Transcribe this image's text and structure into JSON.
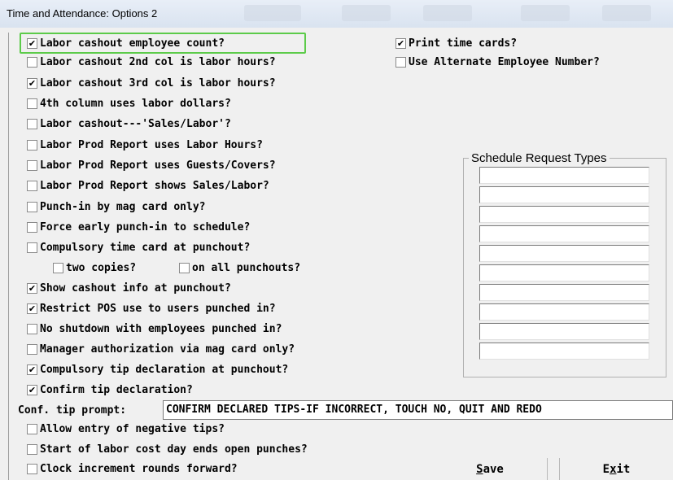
{
  "window": {
    "title": "Time and Attendance: Options 2"
  },
  "left_options": [
    {
      "label": "Labor cashout employee count?",
      "checked": true
    },
    {
      "label": "Labor cashout 2nd col is labor hours?",
      "checked": false
    },
    {
      "label": "Labor cashout 3rd col is labor hours?",
      "checked": true
    },
    {
      "label": "4th column uses labor dollars?",
      "checked": false
    },
    {
      "label": "Labor cashout---'Sales/Labor'?",
      "checked": false
    },
    {
      "label": "Labor Prod Report uses Labor Hours?",
      "checked": false
    },
    {
      "label": "Labor Prod Report uses Guests/Covers?",
      "checked": false
    },
    {
      "label": "Labor Prod Report shows Sales/Labor?",
      "checked": false
    },
    {
      "label": "Punch-in by mag card only?",
      "checked": false
    },
    {
      "label": "Force early punch-in to schedule?",
      "checked": false
    },
    {
      "label": "Compulsory time card at punchout?",
      "checked": false
    },
    {
      "label": "two copies?",
      "checked": false
    },
    {
      "label": "on all punchouts?",
      "checked": false
    },
    {
      "label": "Show cashout info at punchout?",
      "checked": true
    },
    {
      "label": "Restrict POS use to users punched in?",
      "checked": true
    },
    {
      "label": "No shutdown with employees punched in?",
      "checked": false
    },
    {
      "label": "Manager authorization via mag card only?",
      "checked": false
    },
    {
      "label": "Compulsory tip declaration at punchout?",
      "checked": true
    },
    {
      "label": "Confirm tip declaration?",
      "checked": true
    },
    {
      "label": "Allow entry of negative tips?",
      "checked": false
    },
    {
      "label": "Start of labor cost day ends open punches?",
      "checked": false
    },
    {
      "label": "Clock increment rounds forward?",
      "checked": false
    }
  ],
  "right_options": [
    {
      "label": "Print time cards?",
      "checked": true
    },
    {
      "label": "Use Alternate Employee Number?",
      "checked": false
    }
  ],
  "schedule_request_types": {
    "title": "Schedule Request Types",
    "entries": [
      "",
      "",
      "",
      "",
      "",
      "",
      "",
      "",
      "",
      ""
    ]
  },
  "tip_prompt": {
    "label": "Conf. tip prompt:",
    "value": "CONFIRM DECLARED TIPS-IF INCORRECT, TOUCH NO, QUIT AND REDO"
  },
  "buttons": {
    "save": {
      "prefix": "",
      "mnemonic": "S",
      "suffix": "ave"
    },
    "exit": {
      "prefix": "E",
      "mnemonic": "x",
      "suffix": "it"
    }
  }
}
